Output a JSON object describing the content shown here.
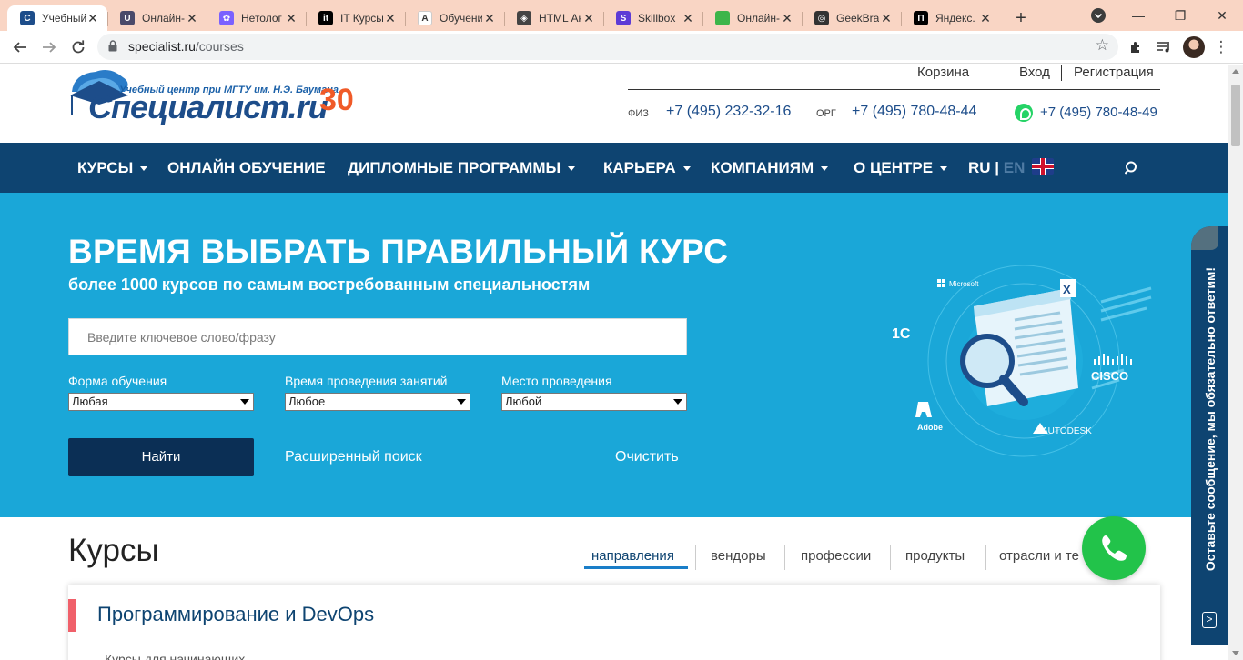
{
  "browser": {
    "tabs": [
      {
        "title": "Учебный",
        "fav_color": "#1d4d8a",
        "fav_letter": "C",
        "active": true
      },
      {
        "title": "Онлайн-",
        "fav_color": "#4a4a6a",
        "fav_letter": "U",
        "active": false
      },
      {
        "title": "Нетолог",
        "fav_color": "#7b61ff",
        "fav_letter": "✿",
        "active": false
      },
      {
        "title": "IT Курсы",
        "fav_color": "#000000",
        "fav_letter": "it",
        "active": false
      },
      {
        "title": "Обучени",
        "fav_color": "#ffffff",
        "fav_letter": "A",
        "active": false
      },
      {
        "title": "HTML Ак",
        "fav_color": "#444444",
        "fav_letter": "◈",
        "active": false
      },
      {
        "title": "Skillbox",
        "fav_color": "#5d3bd6",
        "fav_letter": "S",
        "active": false
      },
      {
        "title": "Онлайн-",
        "fav_color": "#3cb54a",
        "fav_letter": "",
        "active": false
      },
      {
        "title": "GeekBra",
        "fav_color": "#333333",
        "fav_letter": "◎",
        "active": false
      },
      {
        "title": "Яндекс.",
        "fav_color": "#000000",
        "fav_letter": "П",
        "active": false
      }
    ],
    "url_domain": "specialist.ru",
    "url_path": "/courses",
    "icons": {
      "back": "arrow-left-icon",
      "forward": "arrow-right-icon",
      "reload": "reload-icon",
      "star": "star-icon",
      "extensions": "puzzle-icon",
      "media": "media-icon",
      "menu": "kebab-menu-icon"
    }
  },
  "header": {
    "logo_tagline": "Учебный центр при МГТУ им. Н.Э. Баумана",
    "logo_brand": "Специалист",
    "logo_ru": ".ru",
    "logo_anniversary": "30",
    "cart": "Корзина",
    "login": "Вход",
    "register": "Регистрация",
    "phone_fiz_label": "ФИЗ",
    "phone_fiz": "+7 (495) 232-32-16",
    "phone_org_label": "ОРГ",
    "phone_org": "+7 (495) 780-48-44",
    "phone_whatsapp": "+7 (495) 780-48-49"
  },
  "nav": {
    "items": [
      {
        "label": "КУРСЫ",
        "caret": true
      },
      {
        "label": "ОНЛАЙН ОБУЧЕНИЕ",
        "caret": false
      },
      {
        "label": "ДИПЛОМНЫЕ ПРОГРАММЫ",
        "caret": true
      },
      {
        "label": "КАРЬЕРА",
        "caret": true
      },
      {
        "label": "КОМПАНИЯМ",
        "caret": true
      },
      {
        "label": "О ЦЕНТРЕ",
        "caret": true
      }
    ],
    "lang_ru": "RU",
    "lang_sep": " | ",
    "lang_en": "EN"
  },
  "hero": {
    "title": "ВРЕМЯ ВЫБРАТЬ ПРАВИЛЬНЫЙ КУРС",
    "subtitle": "более 1000 курсов по самым востребованным специальностям",
    "search_placeholder": "Введите ключевое слово/фразу",
    "filters": [
      {
        "label": "Форма обучения",
        "value": "Любая"
      },
      {
        "label": "Время проведения занятий",
        "value": "Любое"
      },
      {
        "label": "Место проведения",
        "value": "Любой"
      }
    ],
    "find_button": "Найти",
    "advanced_search": "Расширенный поиск",
    "clear": "Очистить",
    "vendors": {
      "microsoft": "Microsoft",
      "onec": "1С",
      "cisco": "CISCO",
      "adobe": "Adobe",
      "autodesk": "AUTODESK"
    }
  },
  "sidebar_feedback": {
    "text": "Оставьте сообщение, мы обязательно ответим!",
    "chevron": ">"
  },
  "courses": {
    "title": "Курсы",
    "tabs": [
      "направления",
      "вендоры",
      "профессии",
      "продукты",
      "отрасли и те"
    ],
    "active_tab": 0,
    "card_title": "Программирование и DevOps",
    "card_sub": "Курсы для начинающих"
  },
  "colors": {
    "nav": "#0e4471",
    "hero": "#1aa7d8",
    "accent": "#f05a28",
    "call": "#22c34a"
  }
}
